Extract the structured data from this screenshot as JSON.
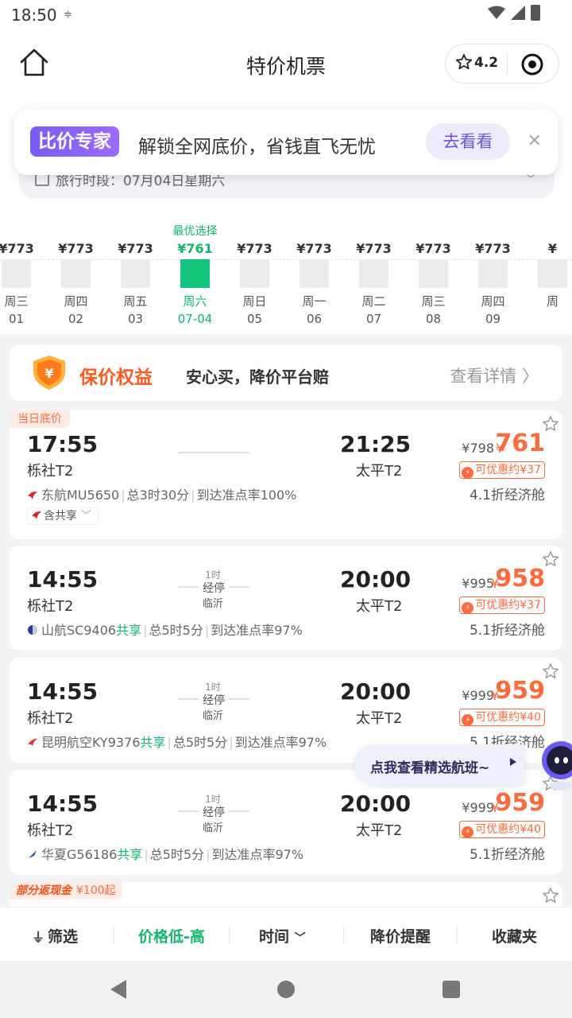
{
  "status_bar": {
    "time": "18:50"
  },
  "nav": {
    "title": "特价机票",
    "rating": "4.2"
  },
  "promo": {
    "badge": "比价专家",
    "text": "解锁全网底价，省钱直飞无忧",
    "button": "去看看"
  },
  "travel": {
    "text": "旅行时段：07月04日星期六"
  },
  "dates": [
    {
      "price": "¥773",
      "weekday": "周三",
      "day": "01"
    },
    {
      "price": "¥773",
      "weekday": "周四",
      "day": "02"
    },
    {
      "price": "¥773",
      "weekday": "周五",
      "day": "03"
    },
    {
      "best_label": "最优选择",
      "price": "¥761",
      "weekday": "周六",
      "day": "07-04",
      "selected": true
    },
    {
      "price": "¥773",
      "weekday": "周日",
      "day": "05"
    },
    {
      "price": "¥773",
      "weekday": "周一",
      "day": "06"
    },
    {
      "price": "¥773",
      "weekday": "周二",
      "day": "07"
    },
    {
      "price": "¥773",
      "weekday": "周三",
      "day": "08"
    },
    {
      "price": "¥773",
      "weekday": "周四",
      "day": "09"
    },
    {
      "price": "¥",
      "weekday": "周",
      "day": ""
    }
  ],
  "guarantee": {
    "title": "保价权益",
    "subtitle": "安心买，降价平台赔",
    "more": "查看详情"
  },
  "flights": [
    {
      "tag": "当日底价",
      "dep_time": "17:55",
      "dep_airport": "栎社T2",
      "arr_time": "21:25",
      "arr_airport": "太平T2",
      "old_price": "¥798",
      "yen": "¥",
      "price": "761",
      "discount": "可优惠约¥37",
      "cabin": "4.1折经济舱",
      "airline": "东航MU5650",
      "share": "",
      "duration": "总3时30分",
      "ontime": "到达准点率100%",
      "share_pill": "含共享"
    },
    {
      "dep_time": "14:55",
      "dep_airport": "栎社T2",
      "stop_duration": "1时",
      "stop_label": "经停",
      "stop_city": "临沂",
      "arr_time": "20:00",
      "arr_airport": "太平T2",
      "old_price": "¥995",
      "yen": "¥",
      "price": "958",
      "discount": "可优惠约¥37",
      "cabin": "5.1折经济舱",
      "airline": "山航SC9406",
      "share": "共享",
      "duration": "总5时5分",
      "ontime": "到达准点率97%"
    },
    {
      "dep_time": "14:55",
      "dep_airport": "栎社T2",
      "stop_duration": "1时",
      "stop_label": "经停",
      "stop_city": "临沂",
      "arr_time": "20:00",
      "arr_airport": "太平T2",
      "old_price": "¥999",
      "yen": "¥",
      "price": "959",
      "discount": "可优惠约¥40",
      "cabin": "5.1折经济舱",
      "airline": "昆明航空KY9376",
      "share": "共享",
      "duration": "总5时5分",
      "ontime": "到达准点率97%"
    },
    {
      "dep_time": "14:55",
      "dep_airport": "栎社T2",
      "stop_duration": "1时",
      "stop_label": "经停",
      "stop_city": "临沂",
      "arr_time": "20:00",
      "arr_airport": "太平T2",
      "old_price": "¥999",
      "yen": "¥",
      "price": "959",
      "discount": "可优惠约¥40",
      "cabin": "5.1折经济舱",
      "airline": "华夏G56186",
      "share": "共享",
      "duration": "总5时5分",
      "ontime": "到达准点率97%"
    }
  ],
  "partial_card": {
    "cashback_tag": "部分返现金",
    "cashback_amount": "¥100起"
  },
  "float_pill": {
    "text": "点我查看精选航班~"
  },
  "bottom_tabs": {
    "filter": "筛选",
    "price": "价格低-高",
    "time": "时间",
    "alert": "降价提醒",
    "favorites": "收藏夹"
  },
  "colors": {
    "accent_green": "#13b76b",
    "price_orange": "#ff6a3d",
    "badge_purple": "#7c5cf5"
  }
}
